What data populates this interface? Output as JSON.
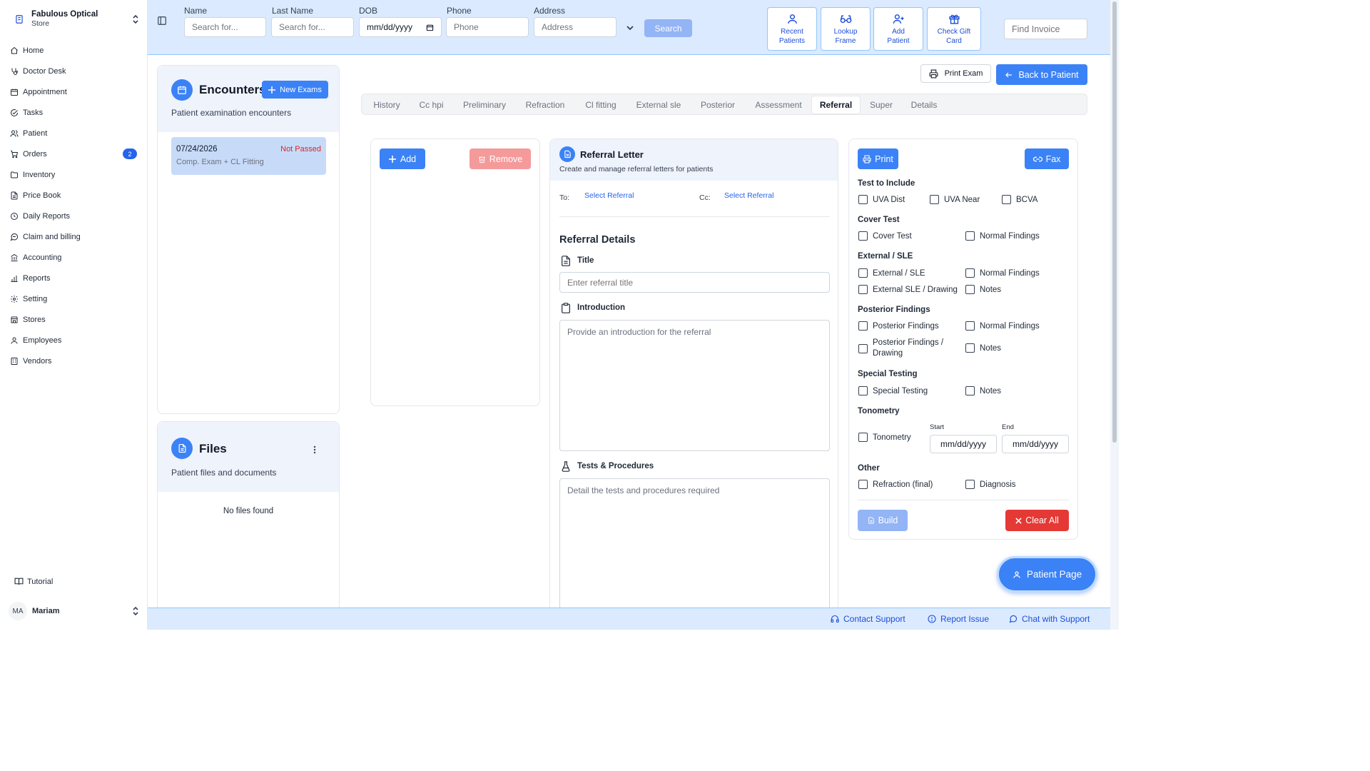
{
  "store": {
    "name": "Fabulous Optical",
    "subtitle": "Store"
  },
  "nav": [
    {
      "label": "Home",
      "icon": "home-icon"
    },
    {
      "label": "Doctor Desk",
      "icon": "stethoscope-icon"
    },
    {
      "label": "Appointment",
      "icon": "calendar-icon"
    },
    {
      "label": "Tasks",
      "icon": "check-circle-icon"
    },
    {
      "label": "Patient",
      "icon": "users-icon"
    },
    {
      "label": "Orders",
      "icon": "cart-icon",
      "badge": "2"
    },
    {
      "label": "Inventory",
      "icon": "folder-icon"
    },
    {
      "label": "Price Book",
      "icon": "document-icon"
    },
    {
      "label": "Daily Reports",
      "icon": "clock-icon"
    },
    {
      "label": "Claim and billing",
      "icon": "message-icon"
    },
    {
      "label": "Accounting",
      "icon": "bank-icon"
    },
    {
      "label": "Reports",
      "icon": "bar-chart-icon"
    },
    {
      "label": "Setting",
      "icon": "gear-icon"
    },
    {
      "label": "Stores",
      "icon": "store-icon"
    },
    {
      "label": "Employees",
      "icon": "user-icon"
    },
    {
      "label": "Vendors",
      "icon": "building-icon"
    }
  ],
  "sidebar_footer": {
    "tutorial": "Tutorial",
    "user_initials": "MA",
    "user_name": "Mariam"
  },
  "search": {
    "name_label": "Name",
    "name_placeholder": "Search for...",
    "last_label": "Last Name",
    "last_placeholder": "Search for...",
    "dob_label": "DOB",
    "dob_placeholder": "mm/dd/yyyy",
    "phone_label": "Phone",
    "phone_placeholder": "Phone",
    "address_label": "Address",
    "address_placeholder": "Address",
    "search_button": "Search",
    "find_invoice_placeholder": "Find Invoice"
  },
  "quick_actions": [
    {
      "line1": "Recent",
      "line2": "Patients"
    },
    {
      "line1": "Lookup",
      "line2": "Frame"
    },
    {
      "line1": "Add",
      "line2": "Patient"
    },
    {
      "line1": "Check Gift",
      "line2": "Card"
    }
  ],
  "encounters": {
    "title": "Encounters",
    "new_button": "New Exams",
    "subtitle": "Patient examination encounters",
    "items": [
      {
        "date": "07/24/2026",
        "status": "Not Passed",
        "desc": "Comp. Exam + CL Fitting"
      }
    ]
  },
  "files": {
    "title": "Files",
    "subtitle": "Patient files and documents",
    "empty": "No files found"
  },
  "top_actions": {
    "print_exam": "Print Exam",
    "back": "Back to Patient"
  },
  "tabs": [
    "History",
    "Cc hpi",
    "Preliminary",
    "Refraction",
    "Cl fitting",
    "External sle",
    "Posterior",
    "Assessment",
    "Referral",
    "Super",
    "Details"
  ],
  "active_tab": "Referral",
  "list_panel": {
    "add": "Add",
    "remove": "Remove"
  },
  "referral": {
    "title": "Referral Letter",
    "subtitle": "Create and manage referral letters for patients",
    "to_label": "To:",
    "to_value": "Select Referral",
    "cc_label": "Cc:",
    "cc_value": "Select Referral",
    "details_heading": "Referral Details",
    "title_label": "Title",
    "title_placeholder": "Enter referral title",
    "intro_label": "Introduction",
    "intro_placeholder": "Provide an introduction for the referral",
    "tests_label": "Tests & Procedures",
    "tests_placeholder": "Detail the tests and procedures required"
  },
  "options": {
    "print": "Print",
    "fax": "Fax",
    "test_include": "Test to Include",
    "uva_dist": "UVA Dist",
    "uva_near": "UVA Near",
    "bcva": "BCVA",
    "cover_test_h": "Cover Test",
    "cover_test": "Cover Test",
    "normal_findings": "Normal Findings",
    "external_h": "External / SLE",
    "external": "External / SLE",
    "external_drawing": "External SLE / Drawing",
    "notes": "Notes",
    "posterior_h": "Posterior Findings",
    "posterior": "Posterior Findings",
    "posterior_drawing_1": "Posterior Findings /",
    "posterior_drawing_2": "Drawing",
    "special_h": "Special Testing",
    "special": "Special Testing",
    "tono_h": "Tonometry",
    "tono": "Tonometry",
    "start": "Start",
    "end": "End",
    "date_placeholder": "mm/dd/yyyy",
    "other_h": "Other",
    "refraction_final": "Refraction (final)",
    "diagnosis": "Diagnosis",
    "build": "Build",
    "clear_all": "Clear All"
  },
  "patient_page": "Patient Page",
  "footer": {
    "contact": "Contact Support",
    "report": "Report Issue",
    "chat": "Chat with Support"
  }
}
